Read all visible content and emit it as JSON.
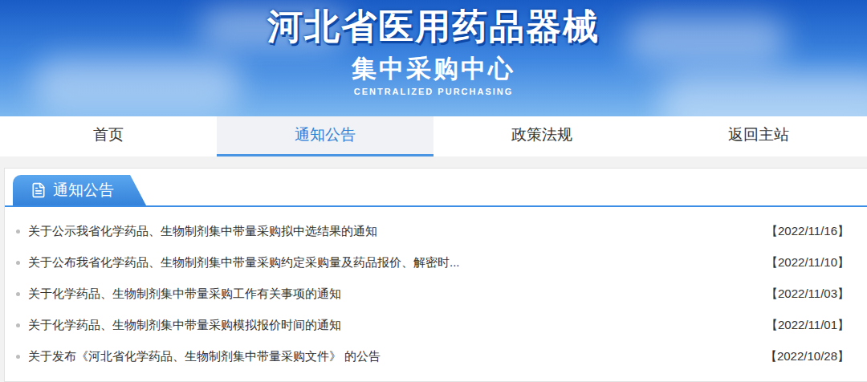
{
  "header": {
    "title": "河北省医用药品器械",
    "subtitle": "集中采购中心",
    "english": "CENTRALIZED PURCHASING"
  },
  "nav": [
    {
      "label": "首页",
      "selected": false
    },
    {
      "label": "通知公告",
      "selected": true
    },
    {
      "label": "政策法规",
      "selected": false
    },
    {
      "label": "返回主站",
      "selected": false
    }
  ],
  "panel": {
    "title": "通知公告"
  },
  "notices": [
    {
      "title": "关于公示我省化学药品、生物制剂集中带量采购拟中选结果的通知",
      "date": "【2022/11/16】"
    },
    {
      "title": "关于公布我省化学药品、生物制剂集中带量采购约定采购量及药品报价、解密时...",
      "date": "【2022/11/10】"
    },
    {
      "title": "关于化学药品、生物制剂集中带量采购工作有关事项的通知",
      "date": "【2022/11/03】"
    },
    {
      "title": "关于化学药品、生物制剂集中带量采购模拟报价时间的通知",
      "date": "【2022/11/01】"
    },
    {
      "title": "关于发布《河北省化学药品、生物制剂集中带量采购文件》 的公告",
      "date": "【2022/10/28】"
    }
  ]
}
